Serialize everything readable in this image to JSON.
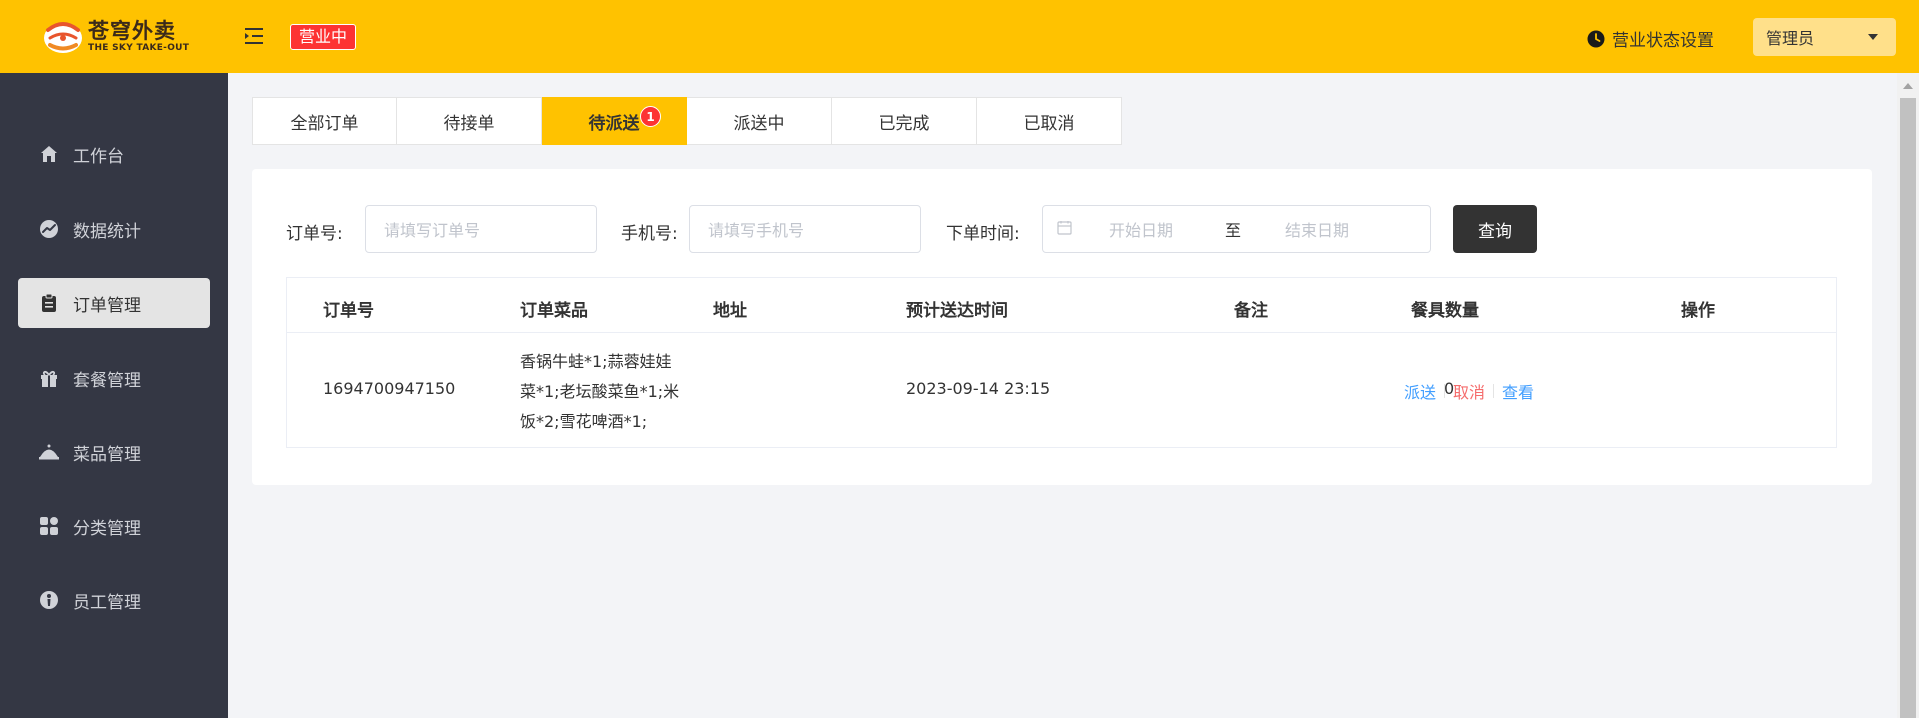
{
  "header": {
    "logo_cn": "苍穹外卖",
    "logo_en": "THE SKY TAKE-OUT",
    "open_status": "营业中",
    "status_setting": "营业状态设置",
    "user": "管理员"
  },
  "sidebar": {
    "items": [
      {
        "label": "工作台",
        "icon": "home-icon"
      },
      {
        "label": "数据统计",
        "icon": "chart-icon"
      },
      {
        "label": "订单管理",
        "icon": "clipboard-icon"
      },
      {
        "label": "套餐管理",
        "icon": "gift-icon"
      },
      {
        "label": "菜品管理",
        "icon": "dish-cloche-icon"
      },
      {
        "label": "分类管理",
        "icon": "category-grid-icon"
      },
      {
        "label": "员工管理",
        "icon": "employee-icon"
      }
    ],
    "active_index": 2
  },
  "tabs": [
    {
      "label": "全部订单"
    },
    {
      "label": "待接单"
    },
    {
      "label": "待派送",
      "count": "1"
    },
    {
      "label": "派送中"
    },
    {
      "label": "已完成"
    },
    {
      "label": "已取消"
    }
  ],
  "search": {
    "order_label": "订单号:",
    "order_placeholder": "请填写订单号",
    "phone_label": "手机号:",
    "phone_placeholder": "请填写手机号",
    "time_label": "下单时间:",
    "start_placeholder": "开始日期",
    "separator": "至",
    "end_placeholder": "结束日期",
    "query_button": "查询"
  },
  "table": {
    "columns": [
      "订单号",
      "订单菜品",
      "地址",
      "预计送达时间",
      "备注",
      "餐具数量",
      "操作"
    ],
    "rows": [
      {
        "order_no": "1694700947150",
        "dishes": "香锅牛蛙*1;蒜蓉娃娃菜*1;老坛酸菜鱼*1;米饭*2;雪花啤酒*1;",
        "address": "",
        "eta": "2023-09-14 23:15",
        "remark": "",
        "tableware": "0",
        "actions": [
          "派送",
          "取消",
          "查看"
        ]
      }
    ]
  },
  "colors": {
    "brand_yellow": "#ffc200",
    "sidebar_bg": "#343744",
    "badge_red": "#fd3333",
    "link_blue": "#419eff",
    "cancel_red": "#f56c6c"
  }
}
